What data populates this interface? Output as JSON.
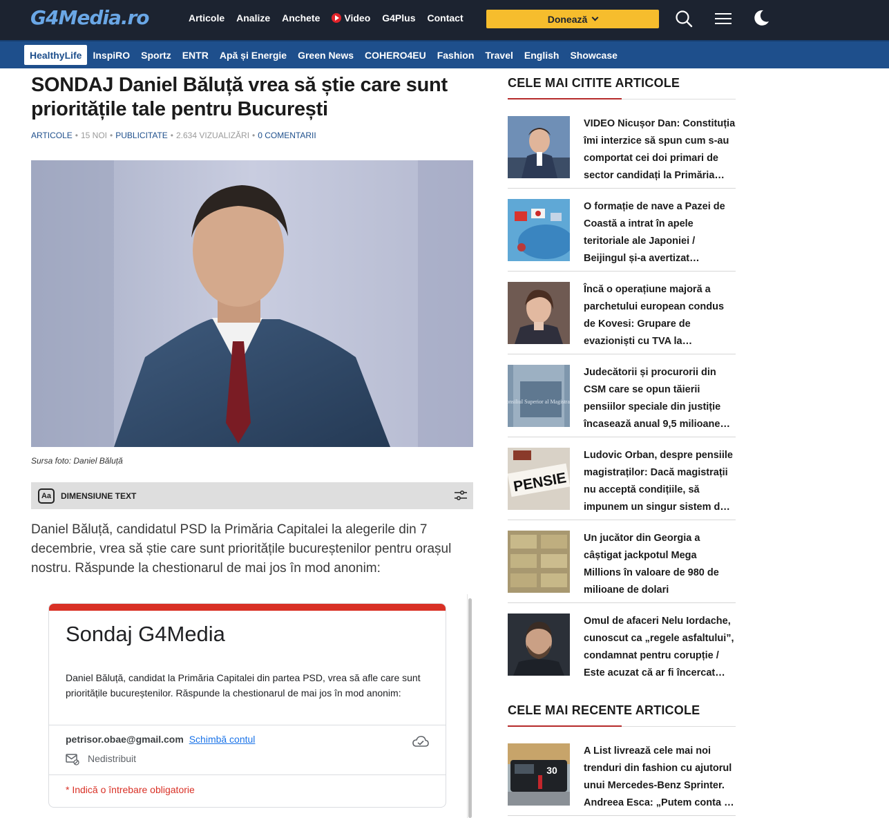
{
  "header": {
    "logo": "G4Media.ro",
    "nav": [
      "Articole",
      "Analize",
      "Anchete",
      "Video",
      "G4Plus",
      "Contact"
    ],
    "donate_label": "Donează",
    "icons": [
      "search-icon",
      "menu-icon",
      "moon-icon"
    ],
    "colors": {
      "topbar": "#1c2330",
      "subbar": "#1e4f8c",
      "donate": "#f6bd2d",
      "accent_red": "#b52a2a"
    }
  },
  "subnav": {
    "items": [
      "HealthyLife",
      "InspiRO",
      "Sportz",
      "ENTR",
      "Apă și Energie",
      "Green News",
      "COHERO4EU",
      "Fashion",
      "Travel",
      "English",
      "Showcase"
    ],
    "active": "HealthyLife"
  },
  "article": {
    "title": "SONDAJ Daniel Băluță vrea să știe care sunt prioritățile tale pentru București",
    "meta": {
      "category": "ARTICOLE",
      "date": "15 NOI",
      "tag": "PUBLICITATE",
      "views": "2.634 VIZUALIZĂRI",
      "comments": "0 COMENTARII"
    },
    "photo_caption": "Sursa foto: Daniel Băluță",
    "text_size_label": "DIMENSIUNE TEXT",
    "text_size_icon": "Aa",
    "body": "Daniel Băluță, candidatul PSD la Primăria Capitalei la alegerile din 7 decembrie, vrea să știe care sunt prioritățile bucureștenilor pentru orașul nostru. Răspunde la chestionarul de mai jos în mod anonim:"
  },
  "form": {
    "title": "Sondaj G4Media",
    "description": "Daniel Băluță, candidat la Primăria Capitalei din partea PSD, vrea să afle care sunt prioritățile bucureștenilor. Răspunde la chestionarul de mai jos în mod anonim:",
    "account": "petrisor.obae@gmail.com",
    "switch_account": "Schimbă contul",
    "sharing": "Nedistribuit",
    "required_note": "* Indică o întrebare obligatorie"
  },
  "sidebar": {
    "most_read_heading": "CELE MAI CITITE ARTICOLE",
    "most_read": [
      {
        "title": "VIDEO Nicușor Dan: Constituția îmi interzice să spun cum s-au comportat cei doi primari de sector candidați la Primăria…"
      },
      {
        "title": "O formație de nave a Pazei de Coastă a intrat în apele teritoriale ale Japoniei / Beijingul și-a avertizat…"
      },
      {
        "title": "Încă o operațiune majoră a parchetului european condus de Kovesi: Grupare de evazioniști cu TVA la…"
      },
      {
        "title": "Judecătorii și procurorii din CSM care se opun tăierii pensiilor speciale din justiție încasează anual 9,5 milioane…",
        "thumb_text": "Consiliul Superior al Magistraturii"
      },
      {
        "title": "Ludovic Orban, despre pensiile magistraților: Dacă magistrații nu acceptă condițiile, să impunem un singur sistem d…",
        "thumb_text": "PENSIE"
      },
      {
        "title": "Un jucător din Georgia a câștigat jackpotul Mega Millions în valoare de 980 de milioane de dolari"
      },
      {
        "title": "Omul de afaceri Nelu Iordache, cunoscut ca „regele asfaltului”, condamnat pentru corupție / Este acuzat că ar fi încercat…"
      }
    ],
    "recent_heading": "CELE MAI RECENTE ARTICOLE",
    "recent": [
      {
        "title": "A List livrează cele mai noi trenduri din fashion cu ajutorul unui Mercedes-Benz Sprinter. Andreea Esca: „Putem conta …",
        "thumb_text": "30"
      }
    ]
  }
}
